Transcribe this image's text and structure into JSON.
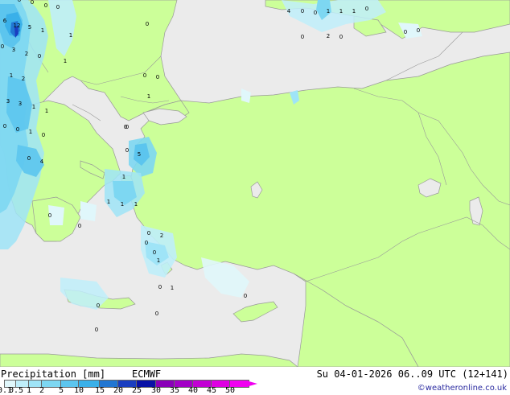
{
  "header": {
    "product": "Precipitation [mm]",
    "model": "ECMWF",
    "valid_time": "Su 04-01-2026 06..09 UTC (12+141)"
  },
  "credit": "©weatheronline.co.uk",
  "colors": {
    "land": "#ccff99",
    "sea": "#ebebeb",
    "coast": "#999999"
  },
  "legend": {
    "ticks": [
      "0.1",
      "0.5",
      "1",
      "2",
      "5",
      "10",
      "15",
      "20",
      "25",
      "30",
      "35",
      "40",
      "45",
      "50"
    ],
    "colors": [
      "#e0f7fb",
      "#bfeefa",
      "#9fe4f7",
      "#7dd7f2",
      "#5cc5ee",
      "#3ab0e9",
      "#2176d2",
      "#1a3ec0",
      "#0a12a6",
      "#8a00b8",
      "#a300c6",
      "#c200d4",
      "#de00e2",
      "#f000f0"
    ]
  },
  "grid_values": [
    "0",
    "6",
    "12",
    "5",
    "1",
    "3",
    "2",
    "0",
    "1",
    "1",
    "2",
    "3",
    "3",
    "1",
    "1",
    "0",
    "0",
    "1",
    "0",
    "0",
    "4",
    "5",
    "0",
    "1",
    "1",
    "1",
    "0",
    "2",
    "1",
    "1",
    "1",
    "0",
    "0",
    "0",
    "1",
    "0",
    "0",
    "1",
    "0",
    "0",
    "0",
    "0",
    "4",
    "0",
    "1",
    "1",
    "1",
    "0",
    "0",
    "0",
    "0",
    "2",
    "0",
    "0",
    "0",
    "0",
    "0",
    "0",
    "0",
    "0",
    "0",
    "0",
    "0"
  ]
}
